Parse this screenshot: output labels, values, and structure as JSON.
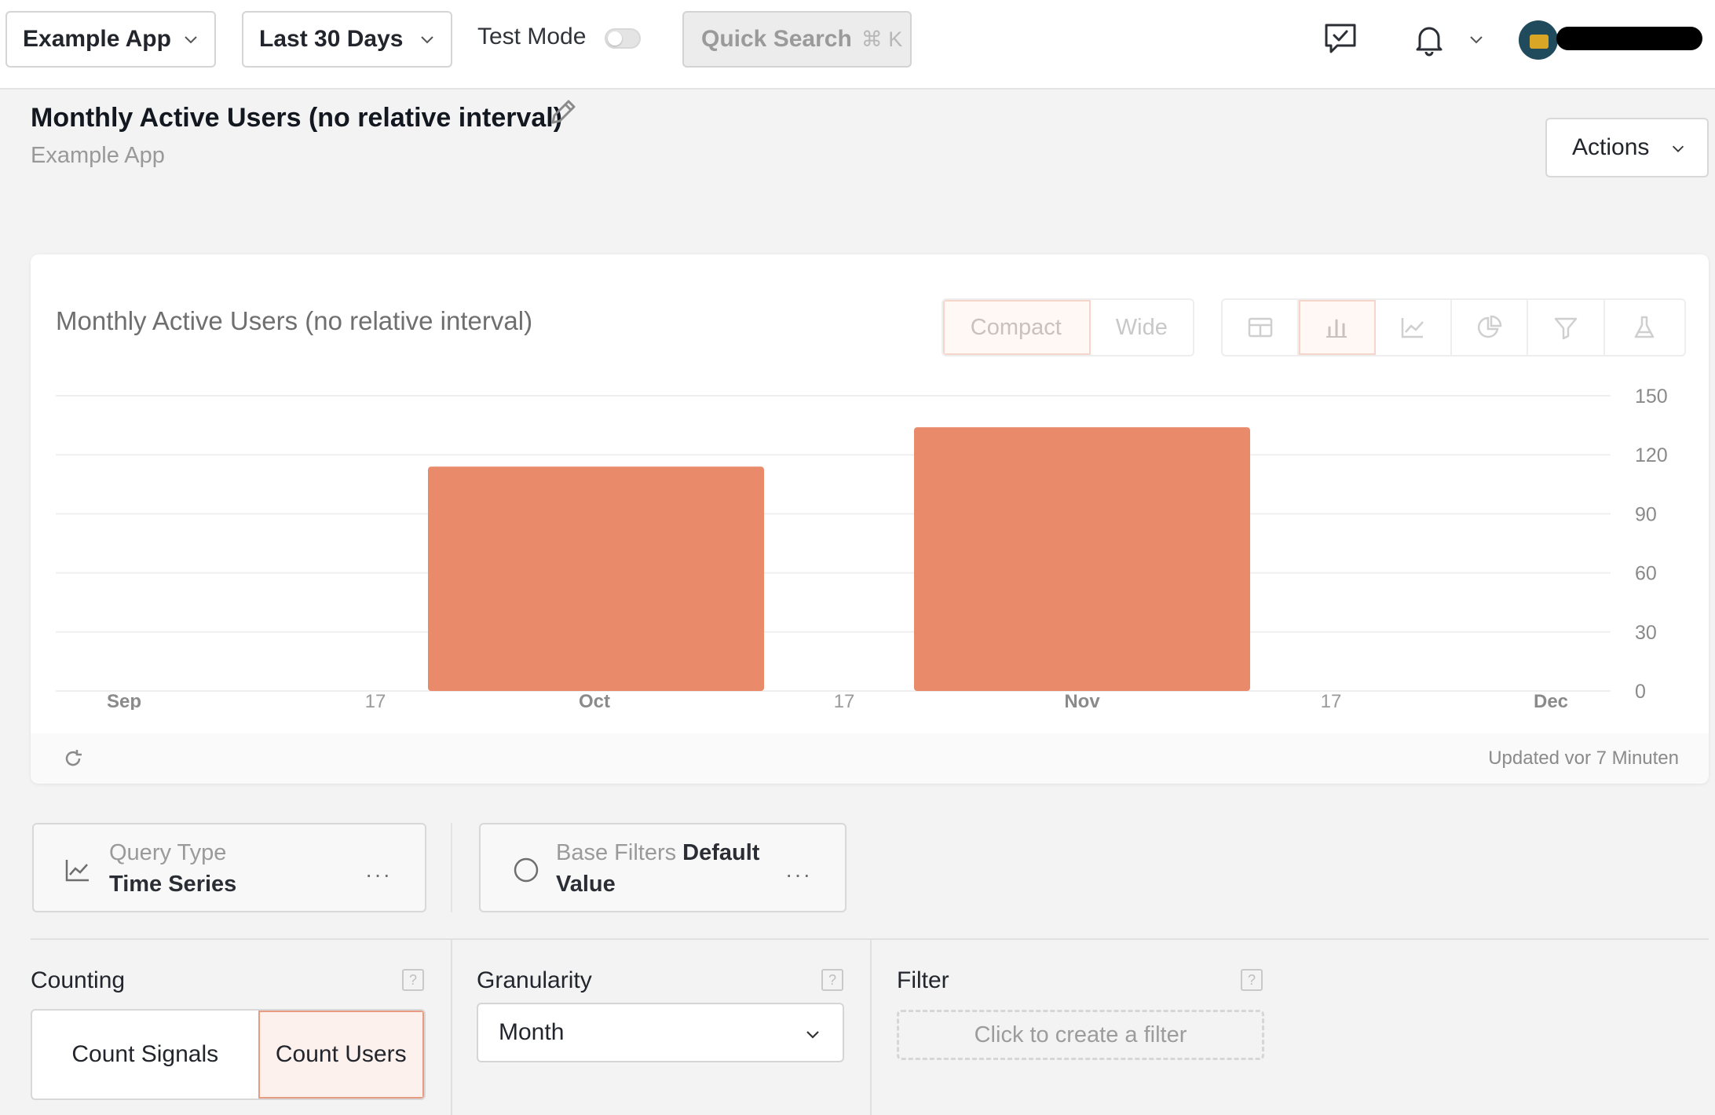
{
  "topbar": {
    "app_select": "Example App",
    "range_select": "Last 30 Days",
    "test_mode_label": "Test Mode",
    "test_mode_on": false,
    "quick_search_label": "Quick Search",
    "quick_search_shortcut": "⌘ K",
    "icons": [
      "feedback-icon",
      "bell-icon",
      "chevron-down-icon",
      "avatar"
    ]
  },
  "header": {
    "title": "Monthly Active Users (no relative interval)",
    "subtitle": "Example App",
    "actions_label": "Actions"
  },
  "card": {
    "title": "Monthly Active Users (no relative interval)",
    "layout_options": [
      "Compact",
      "Wide"
    ],
    "layout_selected": "Compact",
    "view_icons": [
      "table-icon",
      "bar-chart-icon",
      "line-chart-icon",
      "pie-chart-icon",
      "funnel-icon",
      "experiment-icon"
    ],
    "view_selected": "bar-chart-icon",
    "updated_text": "Updated vor 7 Minuten"
  },
  "chart_data": {
    "type": "bar",
    "categories": [
      "Oct",
      "Nov"
    ],
    "values": [
      114,
      134
    ],
    "ylim": [
      0,
      150
    ],
    "y_ticks": [
      "0",
      "30",
      "60",
      "90",
      "120",
      "150"
    ],
    "x_ticks": [
      "Sep",
      "17",
      "Oct",
      "17",
      "Nov",
      "17",
      "Dec"
    ],
    "grid": true,
    "bar_color": "#e98b6b"
  },
  "query": {
    "type_label": "Query Type",
    "type_value": "Time Series",
    "filters_label": "Base Filters",
    "filters_value": "Default Value",
    "more": "···"
  },
  "counting": {
    "label": "Counting",
    "options": [
      "Count Signals",
      "Count Users"
    ],
    "selected": "Count Users"
  },
  "granularity": {
    "label": "Granularity",
    "value": "Month"
  },
  "filter": {
    "label": "Filter",
    "create_label": "Click to create a filter"
  },
  "colors": {
    "accent": "#e98b6b",
    "accent_light": "#fdf1ee"
  }
}
